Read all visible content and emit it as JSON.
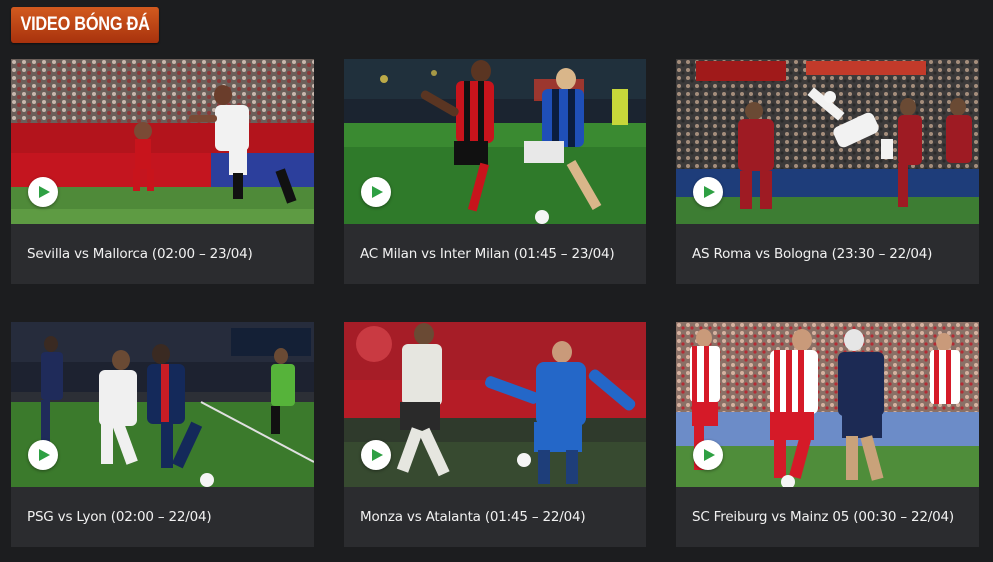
{
  "section": {
    "title": "VIDEO BÓNG ĐÁ"
  },
  "videos": [
    {
      "title": "Sevilla vs Mallorca (02:00 – 23/04)"
    },
    {
      "title": "AC Milan vs Inter Milan (01:45 – 23/04)"
    },
    {
      "title": "AS Roma vs Bologna (23:30 – 22/04)"
    },
    {
      "title": "PSG vs Lyon (02:00 – 22/04)"
    },
    {
      "title": "Monza vs Atalanta (01:45 – 22/04)"
    },
    {
      "title": "SC Freiburg vs Mainz 05 (00:30 – 22/04)"
    }
  ],
  "icons": {
    "play": "play-icon"
  },
  "colors": {
    "background": "#1c1d1f",
    "card": "#2b2c2f",
    "badge": "#b8400f",
    "play_accent": "#2ea043"
  }
}
